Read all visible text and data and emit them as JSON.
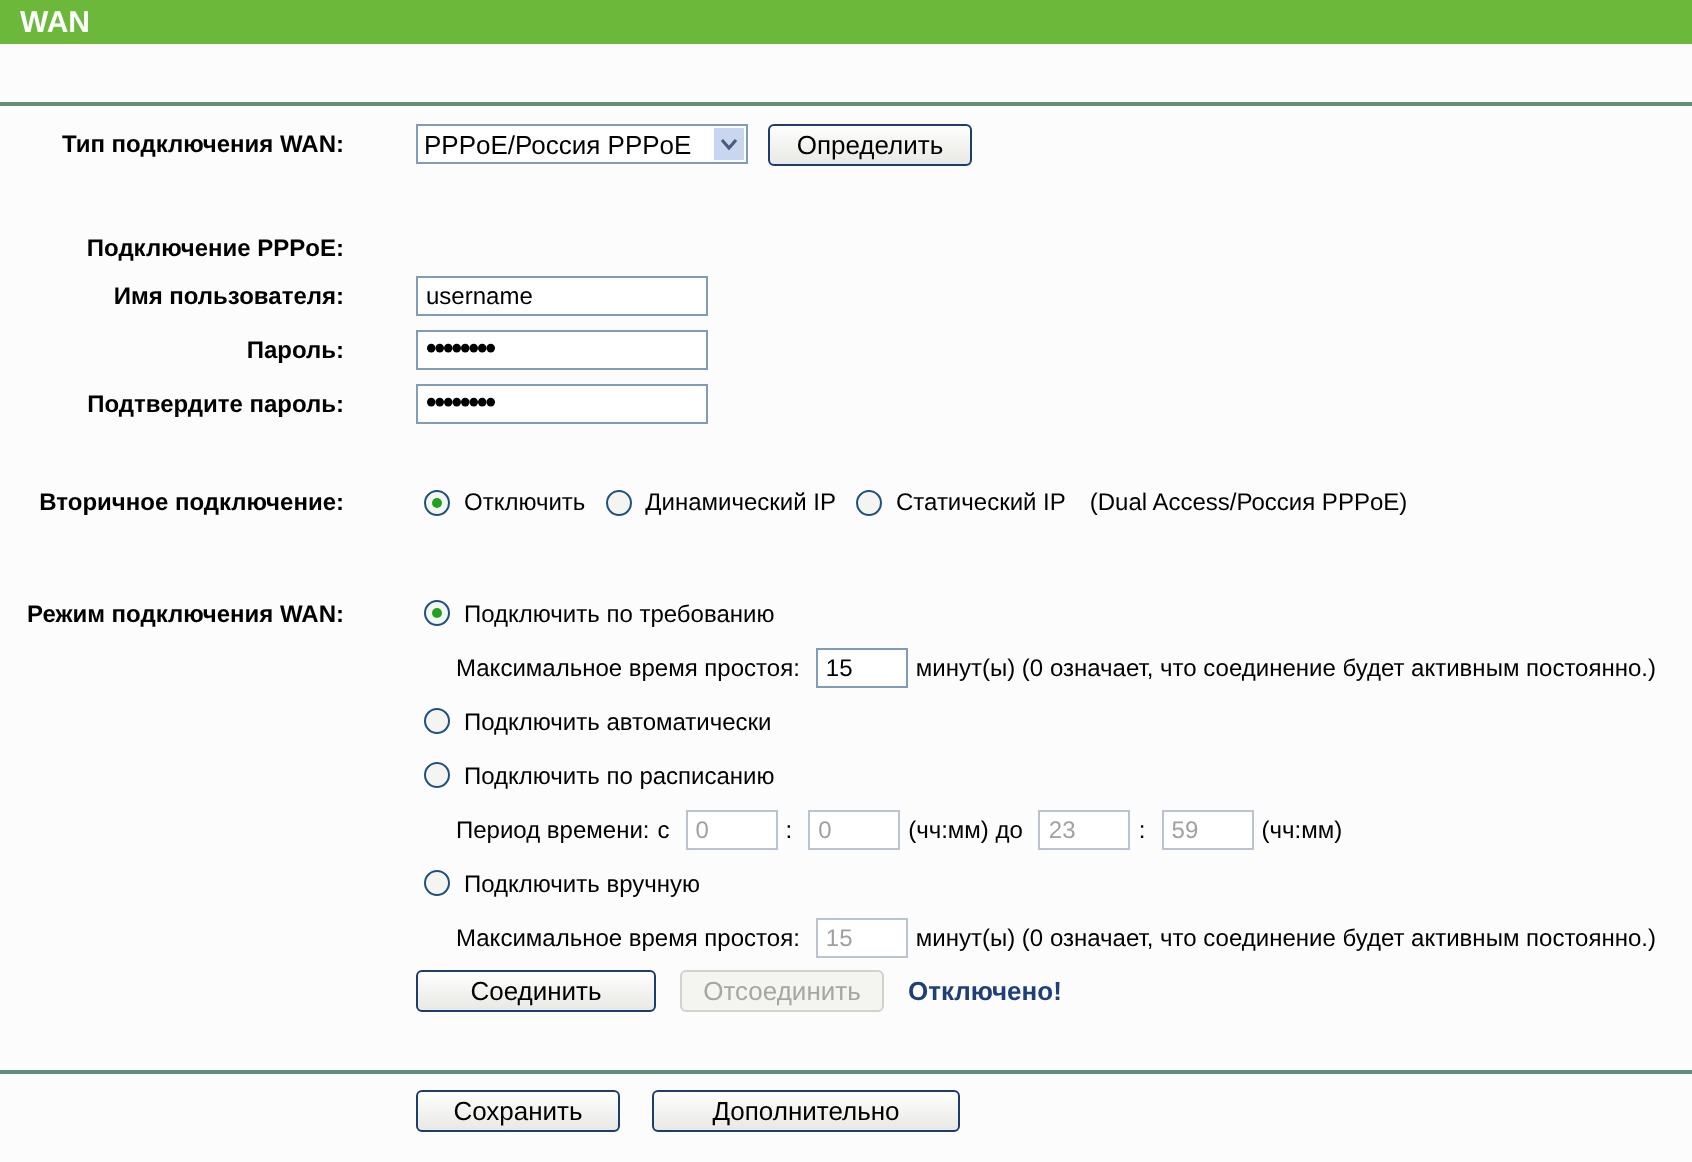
{
  "title": "WAN",
  "connection_type": {
    "label": "Тип подключения WAN:",
    "value": "PPPoE/Россия PPPoE",
    "button": "Определить"
  },
  "pppoe": {
    "heading": "Подключение PPPoE:",
    "fields": [
      {
        "label": "Имя пользователя:",
        "value": "username",
        "kind": "text"
      },
      {
        "label": "Пароль:",
        "value": "••••••••",
        "kind": "password"
      },
      {
        "label": "Подтвердите пароль:",
        "value": "••••••••",
        "kind": "password"
      }
    ]
  },
  "secondary": {
    "label": "Вторичное подключение:",
    "options": [
      {
        "label": "Отключить",
        "selected": true
      },
      {
        "label": "Динамический IP",
        "selected": false
      },
      {
        "label": "Статический IP",
        "selected": false
      }
    ],
    "note": "(Dual Access/Россия PPPoE)"
  },
  "wan_mode": {
    "label": "Режим подключения WAN:",
    "items": [
      {
        "kind": "radio",
        "label": "Подключить по требованию",
        "selected": true
      },
      {
        "kind": "fields",
        "disabled": false,
        "parts": [
          {
            "kind": "text",
            "text": "Максимальное время простоя:"
          },
          {
            "kind": "field",
            "value": "15"
          },
          {
            "kind": "text",
            "text": "минут(ы) (0 означает, что соединение будет активным постоянно.)"
          }
        ]
      },
      {
        "kind": "radio",
        "label": "Подключить автоматически",
        "selected": false
      },
      {
        "kind": "radio",
        "label": "Подключить по расписанию",
        "selected": false
      },
      {
        "kind": "fields",
        "disabled": true,
        "parts": [
          {
            "kind": "text",
            "text": "Период времени:"
          },
          {
            "kind": "text",
            "text": "с"
          },
          {
            "kind": "field",
            "value": "0"
          },
          {
            "kind": "text",
            "text": ":"
          },
          {
            "kind": "field",
            "value": "0"
          },
          {
            "kind": "text",
            "text": "(чч:мм) до"
          },
          {
            "kind": "field",
            "value": "23"
          },
          {
            "kind": "text",
            "text": ":"
          },
          {
            "kind": "field",
            "value": "59"
          },
          {
            "kind": "text",
            "text": "(чч:мм)"
          }
        ]
      },
      {
        "kind": "radio",
        "label": "Подключить вручную",
        "selected": false
      },
      {
        "kind": "fields",
        "disabled": true,
        "parts": [
          {
            "kind": "text",
            "text": "Максимальное время простоя:"
          },
          {
            "kind": "field",
            "value": "15"
          },
          {
            "kind": "text",
            "text": "минут(ы) (0 означает, что соединение будет активным постоянно.)"
          }
        ]
      }
    ],
    "actions": [
      {
        "label": "Соединить",
        "disabled": false
      },
      {
        "label": "Отсоединить",
        "disabled": true
      }
    ],
    "status": "Отключено!"
  },
  "footer_buttons": [
    "Сохранить",
    "Дополнительно"
  ]
}
